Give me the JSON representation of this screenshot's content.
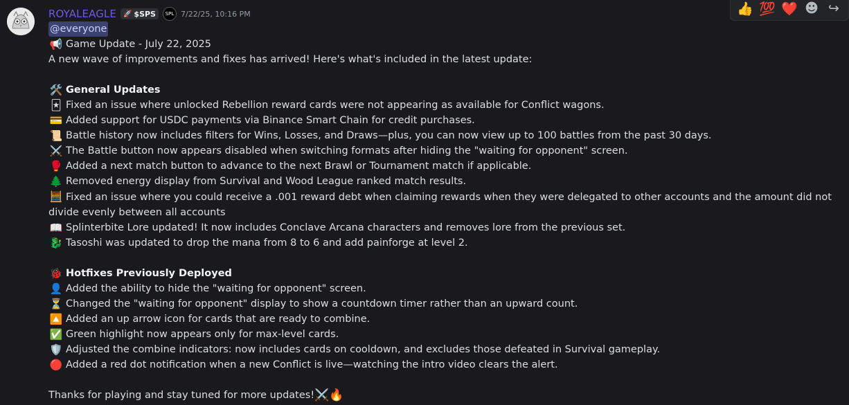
{
  "header": {
    "username": "ROYALEAGLE",
    "tag": "$SPS",
    "tag_icon": "rocket-icon",
    "role_icon_text": "SPL",
    "timestamp": "7/22/25, 10:16 PM"
  },
  "reactions": [
    {
      "emoji": "👍",
      "name": "thumbs-up-reaction"
    },
    {
      "emoji": "💯",
      "name": "hundred-reaction"
    },
    {
      "emoji": "❤️",
      "name": "heart-reaction"
    }
  ],
  "actions": {
    "add_reaction": "☻",
    "reply": "↪"
  },
  "message": {
    "mention": "@everyone",
    "title_emoji": "📢",
    "title": "Game Update - July 22, 2025",
    "intro": " A new wave of improvements and fixes has arrived! Here's what's included in the latest update:",
    "general_heading_emoji": "🛠️",
    "general_heading": "General Updates",
    "general": [
      {
        "emoji": "🃏",
        "text": "Fixed an issue where unlocked Rebellion reward cards were not appearing as available for Conflict wagons."
      },
      {
        "emoji": "💳",
        "text": "Added support for USDC payments via Binance Smart Chain for credit purchases."
      },
      {
        "emoji": "📜",
        "text": "Battle history now includes filters for Wins, Losses, and Draws—plus, you can now view up to 100 battles from the past 30 days."
      },
      {
        "emoji": "⚔️",
        "text": "The Battle button now appears disabled when switching formats after hiding the \"waiting for opponent\" screen."
      },
      {
        "emoji": "🥊",
        "text": "Added a next match button to advance to the next Brawl or Tournament match if applicable."
      },
      {
        "emoji": "🌲",
        "text": "Removed energy display from Survival and Wood League ranked match results."
      },
      {
        "emoji": "🧮",
        "text": "Fixed an issue where you could receive a .001 reward debt when claiming rewards when they were delegated to other accounts and the amount did not divide evenly between all accounts"
      },
      {
        "emoji": "📖",
        "text": "Splinterbite Lore updated! It now includes Conclave Arcana characters and removes lore from the previous set."
      },
      {
        "emoji": "🐉",
        "text": "Tasoshi was updated to drop the mana from 8 to 6 and add painforge at level 2."
      }
    ],
    "hotfix_heading_emoji": "🐞",
    "hotfix_heading": "Hotfixes Previously Deployed",
    "hotfixes": [
      {
        "emoji": "👤",
        "text": "Added the ability to hide the \"waiting for opponent\" screen."
      },
      {
        "emoji": "⏳",
        "text": "Changed the \"waiting for opponent\" display to show a countdown timer rather than an upward count."
      },
      {
        "emoji": "🔼",
        "text": "Added an up arrow icon for cards that are ready to combine."
      },
      {
        "emoji": "✅",
        "text": "Green highlight now appears only for max-level cards."
      },
      {
        "emoji": "🛡️",
        "text": "Adjusted the combine indicators: now includes cards on cooldown, and excludes those defeated in Survival gameplay."
      },
      {
        "emoji": "🔴",
        "text": "Added a red dot notification when a new Conflict is live—watching the intro video clears the alert."
      }
    ],
    "closing": "Thanks for playing and stay tuned for more updates! ",
    "closing_emojis": "⚔️🔥"
  }
}
